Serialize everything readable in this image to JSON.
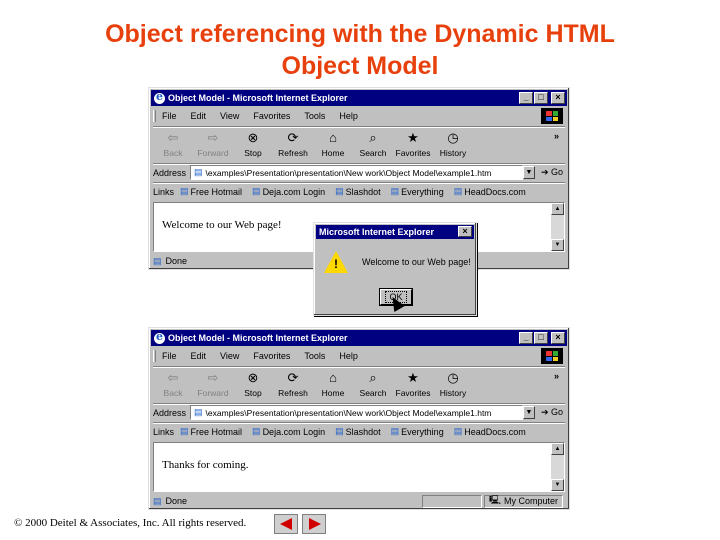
{
  "slide": {
    "title_line1": "Object referencing with the Dynamic HTML",
    "title_line2": "Object Model",
    "footer": "© 2000 Deitel & Associates, Inc.  All rights reserved."
  },
  "browser": {
    "title": "Object Model - Microsoft Internet Explorer",
    "window_buttons": [
      "_",
      "□",
      "×"
    ],
    "menus": [
      "File",
      "Edit",
      "View",
      "Favorites",
      "Tools",
      "Help"
    ],
    "toolbar": [
      {
        "label": "Back",
        "icon": "back-arrow-icon",
        "glyph": "⇦"
      },
      {
        "label": "Forward",
        "icon": "forward-arrow-icon",
        "glyph": "⇨"
      },
      {
        "label": "Stop",
        "icon": "stop-icon",
        "glyph": "⊗"
      },
      {
        "label": "Refresh",
        "icon": "refresh-icon",
        "glyph": "⟳"
      },
      {
        "label": "Home",
        "icon": "home-icon",
        "glyph": "⌂"
      },
      {
        "label": "Search",
        "icon": "search-icon",
        "glyph": "⌕"
      },
      {
        "label": "Favorites",
        "icon": "favorites-icon",
        "glyph": "★"
      },
      {
        "label": "History",
        "icon": "history-icon",
        "glyph": "◷"
      }
    ],
    "toolbar_more": "»",
    "address_label": "Address",
    "address_value": "\\examples\\Presentation\\presentation\\New work\\Object Model\\example1.htm",
    "go_label": "Go",
    "links_label": "Links",
    "links": [
      "Free Hotmail",
      "Deja.com Login",
      "Slashdot",
      "Everything",
      "HeadDocs.com"
    ],
    "status_done": "Done",
    "status_zone": "My Computer"
  },
  "window_top": {
    "content_text": "Welcome to our Web page!"
  },
  "window_bottom": {
    "content_text": "Thanks for coming."
  },
  "dialog": {
    "title": "Microsoft Internet Explorer",
    "message": "Welcome to our Web page!",
    "ok_label": "OK",
    "close_label": "×"
  }
}
